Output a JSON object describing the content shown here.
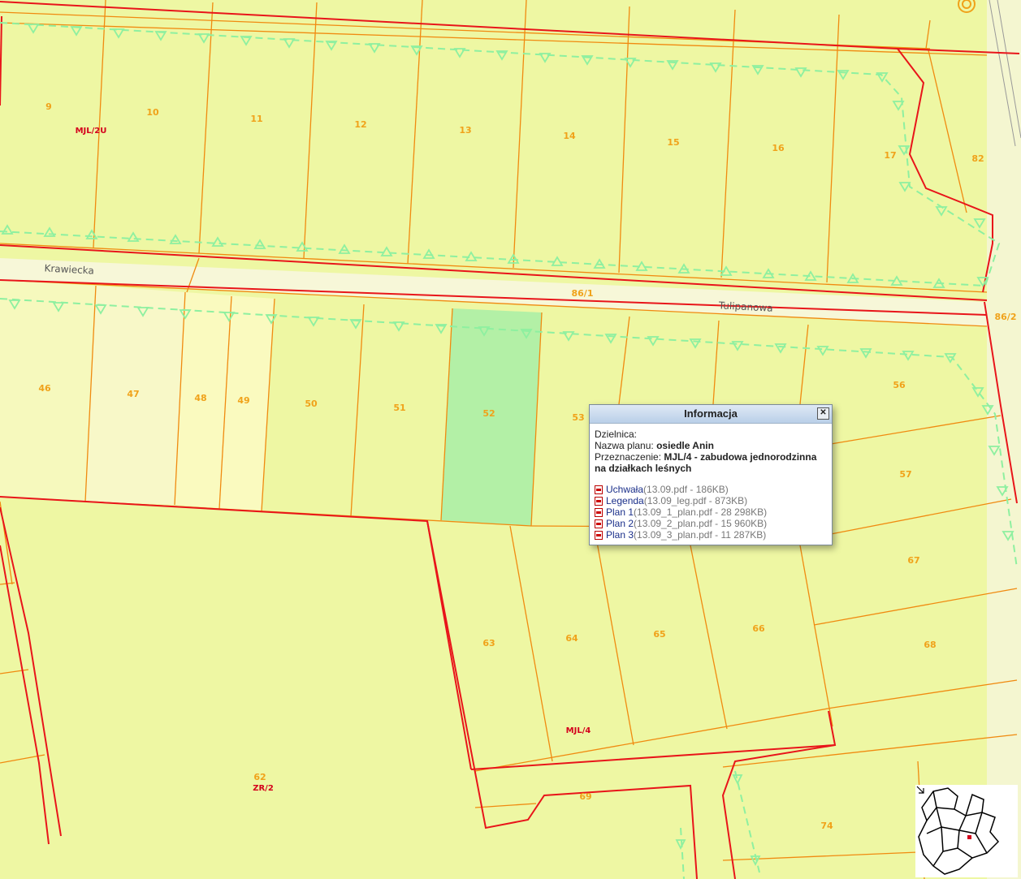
{
  "streets": [
    "Krawiecka",
    "Tulipanowa"
  ],
  "parcels": {
    "p9": "9",
    "p10": "10",
    "p11": "11",
    "p12": "12",
    "p13": "13",
    "p14": "14",
    "p15": "15",
    "p16": "16",
    "p17": "17",
    "p82": "82",
    "p86_1": "86/1",
    "p86_2": "86/2",
    "p46": "46",
    "p47": "47",
    "p48": "48",
    "p49": "49",
    "p50": "50",
    "p51": "51",
    "p52": "52",
    "p53": "53",
    "p56": "56",
    "p57": "57",
    "p67": "67",
    "p68": "68",
    "p62": "62",
    "p63": "63",
    "p64": "64",
    "p65": "65",
    "p66": "66",
    "p69": "69",
    "p74": "74"
  },
  "zones": {
    "mjl2u": "MJL/2U",
    "mjl4": "MJL/4",
    "zr2": "ZR/2"
  },
  "colors": {
    "background": "#eef7a3",
    "selected_parcel": "#b3f0a6",
    "plan_boundary": "#e8151a",
    "parcel_line": "#f08a10",
    "forest_line": "#8ef0a0"
  },
  "popup": {
    "title": "Informacja",
    "dzielnica_label": "Dzielnica:",
    "nazwa_label": "Nazwa planu:",
    "nazwa_value": "osiedle Anin",
    "przeznaczenie_label": "Przeznaczenie:",
    "przeznaczenie_value": "MJL/4 - zabudowa jednorodzinna na działkach leśnych",
    "documents": [
      {
        "name": "Uchwała",
        "meta": "(13.09.pdf - 186KB)"
      },
      {
        "name": "Legenda",
        "meta": "(13.09_leg.pdf - 873KB)"
      },
      {
        "name": "Plan 1",
        "meta": "(13.09_1_plan.pdf - 28 298KB)"
      },
      {
        "name": "Plan 2",
        "meta": "(13.09_2_plan.pdf - 15 960KB)"
      },
      {
        "name": "Plan 3",
        "meta": "(13.09_3_plan.pdf - 11 287KB)"
      }
    ],
    "close_icon": "close-icon"
  }
}
